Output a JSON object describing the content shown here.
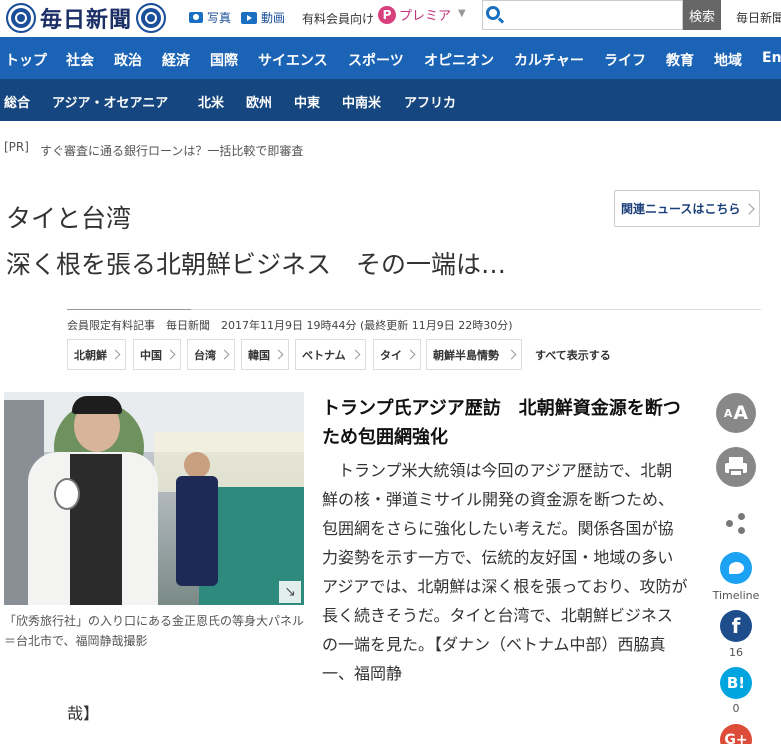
{
  "header": {
    "logo_text": "毎日新聞",
    "photo_label": "写真",
    "video_label": "動画",
    "member_label": "有料会員向け",
    "premier_badge": "P",
    "premier_label": "プレミア",
    "premier_caret": "▼",
    "search_placeholder": "",
    "search_button": "検索",
    "site_name": "毎日新聞"
  },
  "main_nav": [
    "トップ",
    "社会",
    "政治",
    "経済",
    "国際",
    "サイエンス",
    "スポーツ",
    "オピニオン",
    "カルチャー",
    "ライフ",
    "教育",
    "地域",
    "En"
  ],
  "sub_nav": [
    "総合",
    "アジア・オセアニア",
    "北米",
    "欧州",
    "中東",
    "中南米",
    "アフリカ"
  ],
  "sub_nav_active": "アジア・オセアニア",
  "pr": {
    "tag": "[PR]",
    "text": "すぐ審査に通る銀行ローンは？一括比較で即審査"
  },
  "article": {
    "kicker": "タイと台湾",
    "headline": "深く根を張る北朝鮮ビジネス　その一端は…",
    "related_button": "関連ニュースはこちら",
    "meta": "会員限定有料記事　毎日新聞　2017年11月9日 19時44分 (最終更新 11月9日 22時30分)",
    "tags": [
      "北朝鮮",
      "中国",
      "台湾",
      "韓国",
      "ベトナム",
      "タイ",
      "朝鮮半島情勢"
    ],
    "show_all": "すべて表示する",
    "photo_caption": "「欣秀旅行社」の入り口にある金正恩氏の等身大パネル＝台北市で、福岡静哉撮影",
    "subtitle": "トランプ氏アジア歴訪　北朝鮮資金源を断つため包囲網強化",
    "body": "トランプ米大統領は今回のアジア歴訪で、北朝鮮の核・弾道ミサイル開発の資金源を断つため、包囲網をさらに強化したい考えだ。関係各国が協力姿勢を示す一方で、伝統的友好国・地域の多いアジアでは、北朝鮮は深く根を張っており、攻防が長く続きそうだ。タイと台湾で、北朝鮮ビジネスの一端を見た。【ダナン（ベトナム中部）西脇真一、福岡静",
    "body_tail": "哉】"
  },
  "tools": {
    "font_small": "A",
    "font_large": "A",
    "twitter_label": "Timeline",
    "facebook_letter": "f",
    "facebook_count": "16",
    "hatena_letter": "B!",
    "hatena_count": "0",
    "google_letter": "G+"
  },
  "colors": {
    "main_nav": "#1b63b5",
    "sub_nav": "#16467f",
    "brand": "#1b2f66",
    "premier": "#d8407d"
  }
}
